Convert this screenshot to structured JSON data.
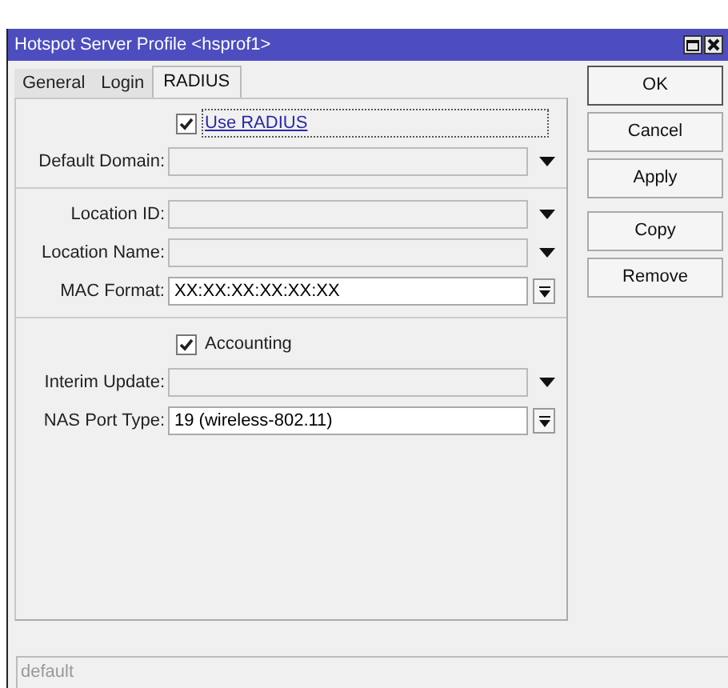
{
  "window": {
    "title": "Hotspot Server Profile <hsprof1>"
  },
  "tabs": [
    {
      "label": "General",
      "selected": false
    },
    {
      "label": "Login",
      "selected": false
    },
    {
      "label": "RADIUS",
      "selected": true
    }
  ],
  "form": [
    {
      "kind": "checkbox",
      "label": "Use RADIUS",
      "checked": true,
      "focused": true
    },
    {
      "kind": "dropdown",
      "label": "Default Domain:"
    },
    {
      "kind": "separator"
    },
    {
      "kind": "dropdown",
      "label": "Location ID:"
    },
    {
      "kind": "dropdown",
      "label": "Location Name:"
    },
    {
      "kind": "select",
      "label": "MAC Format:",
      "value": "XX:XX:XX:XX:XX:XX"
    },
    {
      "kind": "separator"
    },
    {
      "kind": "checkbox",
      "label": "Accounting",
      "checked": true,
      "focused": false
    },
    {
      "kind": "dropdown",
      "label": "Interim Update:"
    },
    {
      "kind": "select",
      "label": "NAS Port Type:",
      "value": "19 (wireless-802.11)"
    }
  ],
  "buttons": [
    {
      "label": "OK",
      "default": true
    },
    {
      "label": "Cancel",
      "default": false
    },
    {
      "label": "Apply",
      "default": false
    },
    {
      "label": "Copy",
      "default": false
    },
    {
      "label": "Remove",
      "default": false
    }
  ],
  "status_bar": "default"
}
